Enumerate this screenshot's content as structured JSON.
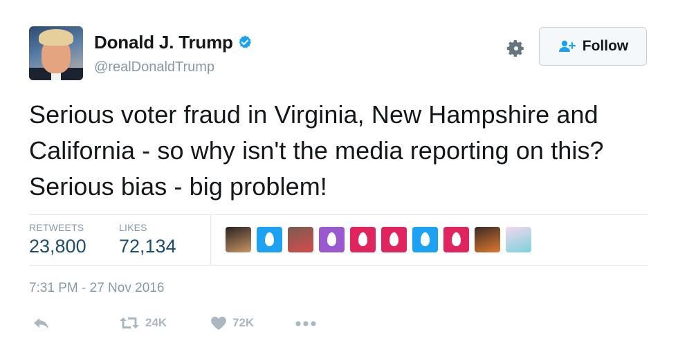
{
  "user": {
    "display_name": "Donald J. Trump",
    "handle": "@realDonaldTrump",
    "verified": true
  },
  "follow": {
    "label": "Follow"
  },
  "tweet": {
    "text": "Serious voter fraud in Virginia, New Hampshire and California - so why isn't the media reporting on this? Serious bias - big problem!"
  },
  "stats": {
    "retweets_label": "RETWEETS",
    "retweets": "23,800",
    "likes_label": "LIKES",
    "likes": "72,134"
  },
  "likers": [
    {
      "kind": "photo",
      "colors": [
        "#2a2320",
        "#c99566"
      ]
    },
    {
      "kind": "egg",
      "colors": [
        "#1da1f2"
      ]
    },
    {
      "kind": "photo",
      "colors": [
        "#7a5c52",
        "#d64b4b"
      ]
    },
    {
      "kind": "egg",
      "colors": [
        "#9b59d0"
      ]
    },
    {
      "kind": "egg",
      "colors": [
        "#e0245e"
      ]
    },
    {
      "kind": "egg",
      "colors": [
        "#e0245e"
      ]
    },
    {
      "kind": "egg",
      "colors": [
        "#1da1f2"
      ]
    },
    {
      "kind": "egg",
      "colors": [
        "#e0245e"
      ]
    },
    {
      "kind": "photo",
      "colors": [
        "#3b2a24",
        "#e07a2e"
      ]
    },
    {
      "kind": "photo",
      "colors": [
        "#f4d6f0",
        "#7ad3d8"
      ]
    }
  ],
  "timestamp": "7:31 PM - 27 Nov 2016",
  "actions": {
    "reply_icon": "reply-icon",
    "retweet_count": "24K",
    "like_count": "72K",
    "more_icon": "more-icon"
  },
  "colors": {
    "accent": "#1da1f2",
    "stat_value": "#1b4f72",
    "muted": "#8899a6"
  }
}
